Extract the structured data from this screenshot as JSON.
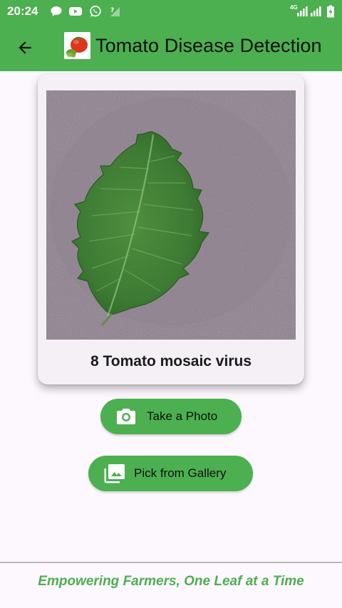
{
  "status_bar": {
    "time": "20:24",
    "network_label": "4G",
    "left_icons": [
      "message-bubble-icon",
      "youtube-icon",
      "whatsapp-icon",
      "wifi-question-icon"
    ],
    "right_icons": [
      "signal-icon",
      "signal-icon",
      "battery-charging-icon"
    ]
  },
  "app_bar": {
    "title": "Tomato Disease Detection",
    "back_icon": "arrow-back-icon",
    "logo_icon": "tomato-logo-icon"
  },
  "result_card": {
    "image": "tomato-leaf-photo",
    "prediction": "8 Tomato mosaic virus"
  },
  "actions": {
    "take_photo": {
      "label": "Take a Photo",
      "icon": "camera-icon"
    },
    "pick_gallery": {
      "label": "Pick from Gallery",
      "icon": "photo-library-icon"
    }
  },
  "footer": {
    "tagline": "Empowering Farmers, One Leaf at a Time"
  },
  "colors": {
    "primary": "#4caf50",
    "background": "#fdf7fe",
    "card": "#f4f0f6"
  }
}
